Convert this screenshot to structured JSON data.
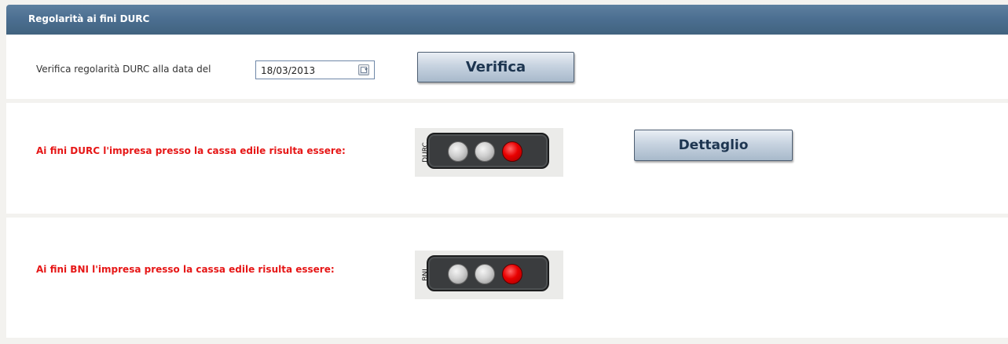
{
  "header": {
    "title": "Regolarità ai fini DURC"
  },
  "verify_row": {
    "label": "Verifica regolarità DURC alla data del",
    "date_value": "18/03/2013",
    "verify_button": "Verifica"
  },
  "durc": {
    "label": "Ai fini DURC l'impresa presso la cassa edile risulta essere:",
    "indicator_tag": "DURC",
    "lights": [
      "off",
      "off",
      "red"
    ],
    "detail_button": "Dettaglio"
  },
  "bni": {
    "label": "Ai fini BNI l'impresa presso la cassa edile risulta essere:",
    "indicator_tag": "BNI",
    "lights": [
      "off",
      "off",
      "red"
    ]
  },
  "colors": {
    "header": "#4b6e90",
    "alert_text": "#e61717",
    "light_red": "#e80000",
    "light_off": "#cfcfcf"
  }
}
